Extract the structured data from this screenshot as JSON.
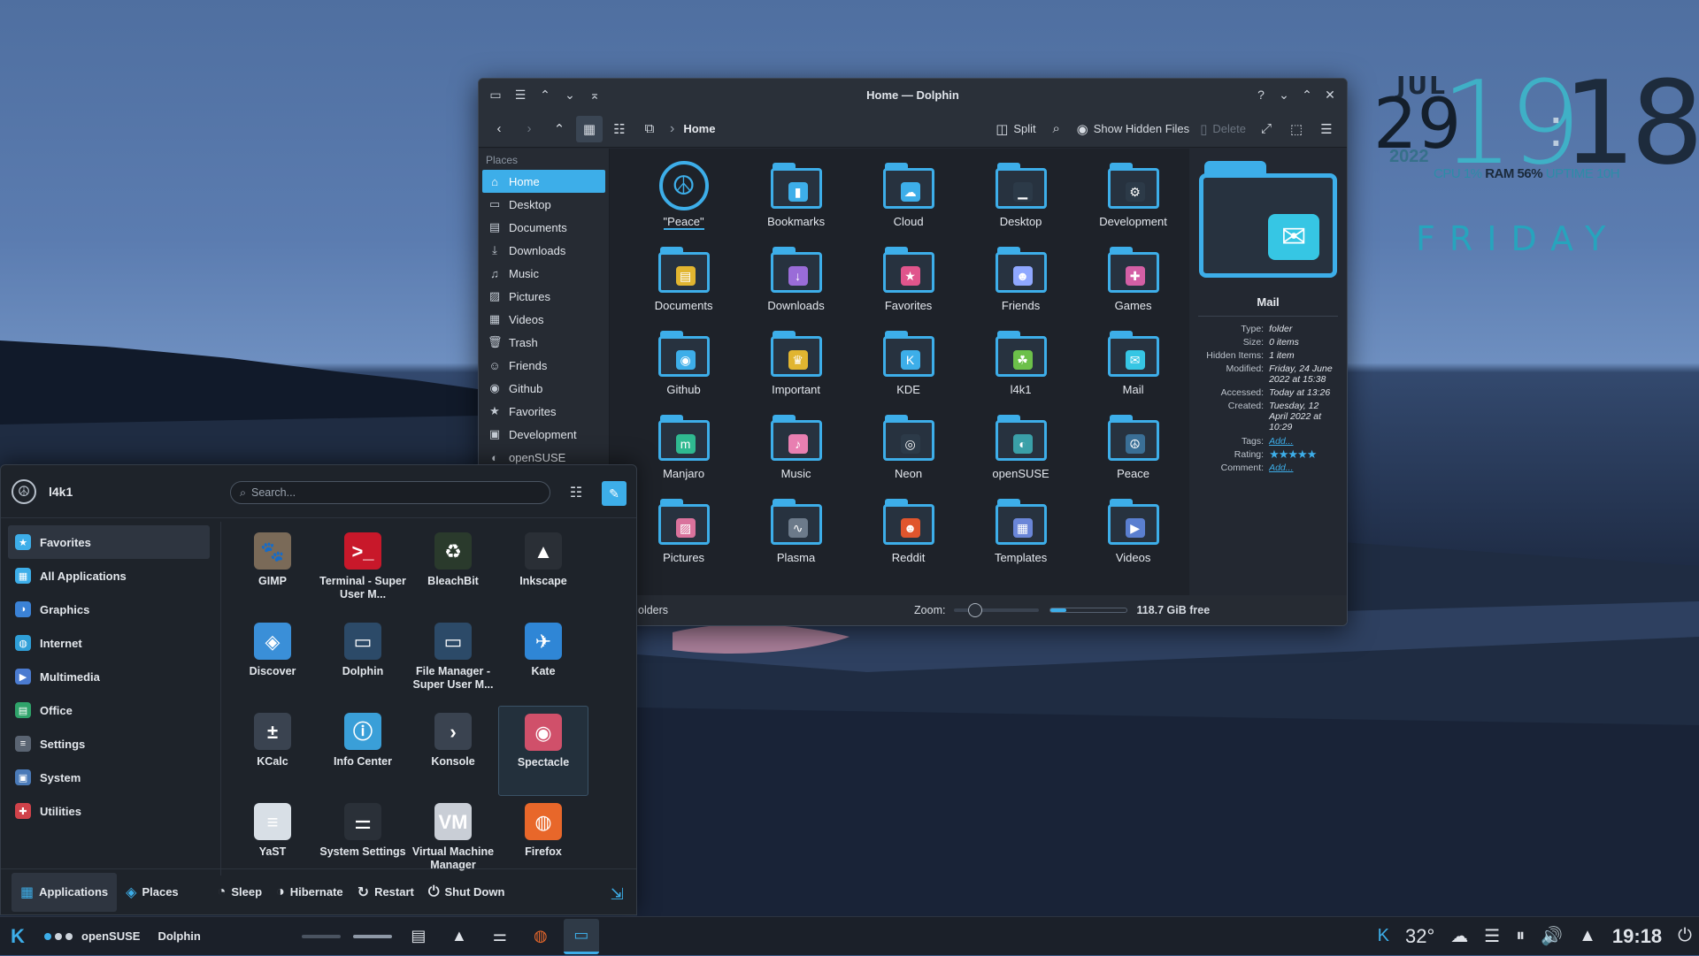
{
  "widget": {
    "month": "JUL",
    "day": "29",
    "hour": "19",
    "minute": "18",
    "year": "2022",
    "stats_cpu": "CPU 1%",
    "stats_ram": "RAM 56%",
    "stats_uptime": "UPTIME 10H",
    "weekday": "FRIDAY"
  },
  "dolphin": {
    "title": "Home — Dolphin",
    "toolbar": {
      "split": "Split",
      "show_hidden": "Show Hidden Files",
      "delete": "Delete",
      "breadcrumb": "Home"
    },
    "places_header": "Places",
    "places": [
      {
        "label": "Home",
        "icon": "home-icon",
        "glyph": "⌂"
      },
      {
        "label": "Desktop",
        "icon": "desktop-icon",
        "glyph": "▭"
      },
      {
        "label": "Documents",
        "icon": "documents-icon",
        "glyph": "▤"
      },
      {
        "label": "Downloads",
        "icon": "downloads-icon",
        "glyph": "⤓"
      },
      {
        "label": "Music",
        "icon": "music-icon",
        "glyph": "♫"
      },
      {
        "label": "Pictures",
        "icon": "pictures-icon",
        "glyph": "▨"
      },
      {
        "label": "Videos",
        "icon": "videos-icon",
        "glyph": "▦"
      },
      {
        "label": "Trash",
        "icon": "trash-icon",
        "glyph": "🗑"
      },
      {
        "label": "Friends",
        "icon": "friends-icon",
        "glyph": "☺"
      },
      {
        "label": "Github",
        "icon": "github-icon",
        "glyph": "◉"
      },
      {
        "label": "Favorites",
        "icon": "star-icon",
        "glyph": "★"
      },
      {
        "label": "Development",
        "icon": "development-icon",
        "glyph": "▣"
      },
      {
        "label": "openSUSE",
        "icon": "opensuse-icon",
        "glyph": "◐"
      }
    ],
    "files": [
      {
        "label": "\"Peace\"",
        "icon": "peace-icon",
        "glyph": "☮",
        "color": "#3daee9"
      },
      {
        "label": "Bookmarks",
        "icon": "bookmarks-icon",
        "glyph": "▮",
        "color": "#3daee9"
      },
      {
        "label": "Cloud",
        "icon": "cloud-icon",
        "glyph": "☁",
        "color": "#3daee9"
      },
      {
        "label": "Desktop",
        "icon": "desktop-folder-icon",
        "glyph": "▁",
        "color": "#2c3a48"
      },
      {
        "label": "Development",
        "icon": "development-folder-icon",
        "glyph": "⚙",
        "color": "#2c3a48"
      },
      {
        "label": "Documents",
        "icon": "documents-folder-icon",
        "glyph": "▤",
        "color": "#e1b530"
      },
      {
        "label": "Downloads",
        "icon": "downloads-folder-icon",
        "glyph": "↓",
        "color": "#9a6cd8"
      },
      {
        "label": "Favorites",
        "icon": "favorites-folder-icon",
        "glyph": "★",
        "color": "#e0558c"
      },
      {
        "label": "Friends",
        "icon": "friends-folder-icon",
        "glyph": "☻",
        "color": "#8fa8ff"
      },
      {
        "label": "Games",
        "icon": "games-folder-icon",
        "glyph": "✚",
        "color": "#d35fa5"
      },
      {
        "label": "Github",
        "icon": "github-folder-icon",
        "glyph": "◉",
        "color": "#3daee9"
      },
      {
        "label": "Important",
        "icon": "important-folder-icon",
        "glyph": "♛",
        "color": "#e1b530"
      },
      {
        "label": "KDE",
        "icon": "kde-folder-icon",
        "glyph": "K",
        "color": "#3daee9"
      },
      {
        "label": "l4k1",
        "icon": "user-folder-icon",
        "glyph": "☘",
        "color": "#6cc04a"
      },
      {
        "label": "Mail",
        "icon": "mail-folder-icon",
        "glyph": "✉",
        "color": "#36c6e4"
      },
      {
        "label": "Manjaro",
        "icon": "manjaro-folder-icon",
        "glyph": "m",
        "color": "#2fb990"
      },
      {
        "label": "Music",
        "icon": "music-folder-icon",
        "glyph": "♪",
        "color": "#e87fb1"
      },
      {
        "label": "Neon",
        "icon": "neon-folder-icon",
        "glyph": "◎",
        "color": "#2c3a48"
      },
      {
        "label": "openSUSE",
        "icon": "opensuse-folder-icon",
        "glyph": "◐",
        "color": "#3aa0a8"
      },
      {
        "label": "Peace",
        "icon": "peace-folder-icon",
        "glyph": "☮",
        "color": "#3a6f96"
      },
      {
        "label": "Pictures",
        "icon": "pictures-folder-icon",
        "glyph": "▨",
        "color": "#d9729c"
      },
      {
        "label": "Plasma",
        "icon": "plasma-folder-icon",
        "glyph": "∿",
        "color": "#6c7a8a"
      },
      {
        "label": "Reddit",
        "icon": "reddit-folder-icon",
        "glyph": "☻",
        "color": "#e0552d"
      },
      {
        "label": "Templates",
        "icon": "templates-folder-icon",
        "glyph": "▦",
        "color": "#6a86d8"
      },
      {
        "label": "Videos",
        "icon": "videos-folder-icon",
        "glyph": "▶",
        "color": "#5a7fd0"
      }
    ],
    "info": {
      "name": "Mail",
      "rows": [
        {
          "k": "Type:",
          "v": "folder"
        },
        {
          "k": "Size:",
          "v": "0 items"
        },
        {
          "k": "Hidden Items:",
          "v": "1 item"
        },
        {
          "k": "Modified:",
          "v": "Friday, 24 June 2022 at 15:38"
        },
        {
          "k": "Accessed:",
          "v": "Today at 13:26"
        },
        {
          "k": "Created:",
          "v": "Tuesday, 12 April 2022 at 10:29"
        }
      ],
      "tags_k": "Tags:",
      "tags_v": "Add...",
      "rating_k": "Rating:",
      "rating_v": "★★★★★",
      "comment_k": "Comment:",
      "comment_v": "Add..."
    },
    "status": {
      "folders": "olders",
      "zoom": "Zoom:",
      "free": "118.7 GiB free",
      "zoom_level": 0.2,
      "used_fraction": 0.2
    }
  },
  "launcher": {
    "user": "l4k1",
    "search_placeholder": "Search...",
    "categories": [
      {
        "label": "Favorites",
        "icon": "favorites-icon",
        "glyph": "★",
        "color": "#3daee9"
      },
      {
        "label": "All Applications",
        "icon": "all-apps-icon",
        "glyph": "▦",
        "color": "#3daee9"
      },
      {
        "label": "Graphics",
        "icon": "graphics-icon",
        "glyph": "◑",
        "color": "#3b82d6"
      },
      {
        "label": "Internet",
        "icon": "internet-icon",
        "glyph": "◍",
        "color": "#2f9fd8"
      },
      {
        "label": "Multimedia",
        "icon": "multimedia-icon",
        "glyph": "▶",
        "color": "#4b7bd0"
      },
      {
        "label": "Office",
        "icon": "office-icon",
        "glyph": "▤",
        "color": "#2fa36a"
      },
      {
        "label": "Settings",
        "icon": "settings-icon",
        "glyph": "≡",
        "color": "#5a6472"
      },
      {
        "label": "System",
        "icon": "system-icon",
        "glyph": "▣",
        "color": "#4a7ab8"
      },
      {
        "label": "Utilities",
        "icon": "utilities-icon",
        "glyph": "✚",
        "color": "#d0424a"
      }
    ],
    "apps": [
      {
        "label": "GIMP",
        "icon": "gimp-icon",
        "glyph": "🐾",
        "color": "#7a6a58"
      },
      {
        "label": "Terminal - Super User M...",
        "icon": "terminal-icon",
        "glyph": ">_",
        "color": "#c8182a"
      },
      {
        "label": "BleachBit",
        "icon": "bleachbit-icon",
        "glyph": "♻",
        "color": "#2a3a2c"
      },
      {
        "label": "Inkscape",
        "icon": "inkscape-icon",
        "glyph": "▲",
        "color": "#2a2f36"
      },
      {
        "label": "Discover",
        "icon": "discover-icon",
        "glyph": "◈",
        "color": "#3a8fd8"
      },
      {
        "label": "Dolphin",
        "icon": "dolphin-icon",
        "glyph": "▭",
        "color": "#2c4a68"
      },
      {
        "label": "File Manager - Super User M...",
        "icon": "file-manager-icon",
        "glyph": "▭",
        "color": "#2c4a68"
      },
      {
        "label": "Kate",
        "icon": "kate-icon",
        "glyph": "✈",
        "color": "#2f86d6"
      },
      {
        "label": "KCalc",
        "icon": "kcalc-icon",
        "glyph": "±",
        "color": "#3a4350"
      },
      {
        "label": "Info Center",
        "icon": "info-center-icon",
        "glyph": "ⓘ",
        "color": "#3a9fd8"
      },
      {
        "label": "Konsole",
        "icon": "konsole-icon",
        "glyph": "›",
        "color": "#3a4350"
      },
      {
        "label": "Spectacle",
        "icon": "spectacle-icon",
        "glyph": "◉",
        "color": "#d0506a"
      },
      {
        "label": "YaST",
        "icon": "yast-icon",
        "glyph": "≡",
        "color": "#d8dfe6"
      },
      {
        "label": "System Settings",
        "icon": "system-settings-icon",
        "glyph": "⚌",
        "color": "#2a3038"
      },
      {
        "label": "Virtual Machine Manager",
        "icon": "vmm-icon",
        "glyph": "VM",
        "color": "#c9ced6"
      },
      {
        "label": "Firefox",
        "icon": "firefox-icon",
        "glyph": "◍",
        "color": "#e8672a"
      }
    ],
    "footer": {
      "applications": "Applications",
      "places": "Places",
      "sleep": "Sleep",
      "hibernate": "Hibernate",
      "restart": "Restart",
      "shutdown": "Shut Down"
    }
  },
  "taskbar": {
    "distro": "openSUSE",
    "active_app": "Dolphin",
    "temperature": "32°",
    "clock": "19:18"
  }
}
